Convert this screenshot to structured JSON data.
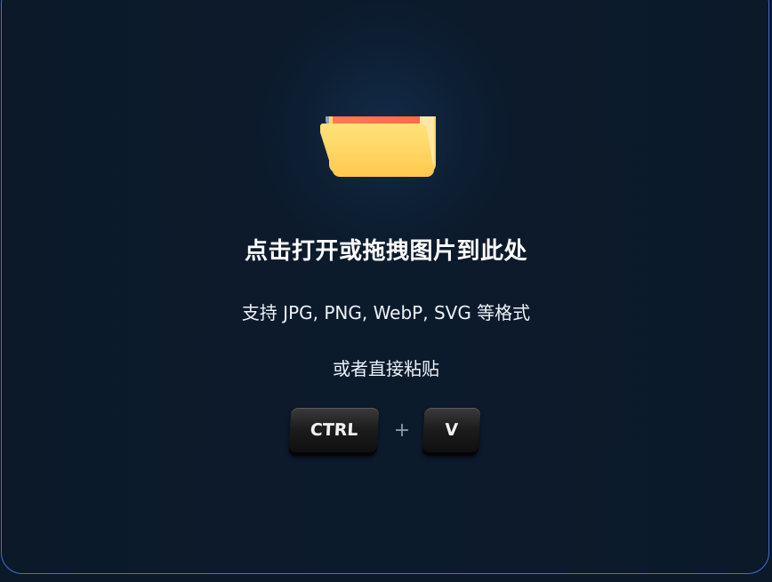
{
  "dropzone": {
    "icon": "folder-icon",
    "title": "点击打开或拖拽图片到此处",
    "formats_text": "支持 JPG, PNG, WebP, SVG 等格式",
    "paste_hint": "或者直接粘贴",
    "shortcut": {
      "key1": "CTRL",
      "separator": "+",
      "key2": "V"
    }
  },
  "colors": {
    "background": "#0b1929",
    "border": "#3f6fd0",
    "folder_front": "#ffd666",
    "folder_tab": "#ff7b4a"
  }
}
